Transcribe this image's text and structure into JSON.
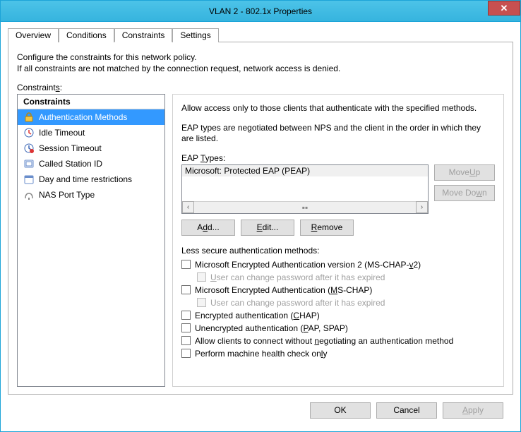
{
  "window": {
    "title": "VLAN 2 - 802.1x Properties",
    "close": "✕"
  },
  "tabs": {
    "overview": "Overview",
    "conditions": "Conditions",
    "constraints": "Constraints",
    "settings": "Settings"
  },
  "intro": {
    "line1": "Configure the constraints for this network policy.",
    "line2": "If all constraints are not matched by the connection request, network access is denied."
  },
  "constraints_label_pre": "Constraint",
  "constraints_label_ul": "s",
  "constraints_label_post": ":",
  "sidebar": {
    "header": "Constraints",
    "items": [
      {
        "label": "Authentication Methods"
      },
      {
        "label": "Idle Timeout"
      },
      {
        "label": "Session Timeout"
      },
      {
        "label": "Called Station ID"
      },
      {
        "label": "Day and time restrictions"
      },
      {
        "label": "NAS Port Type"
      }
    ]
  },
  "right": {
    "allow": "Allow access only to those clients that authenticate with the specified methods.",
    "negotiated": "EAP types are negotiated between NPS and the client in the order in which they are listed.",
    "eap_label_pre": "EAP ",
    "eap_label_ul": "T",
    "eap_label_post": "ypes:",
    "eap0": "Microsoft: Protected EAP (PEAP)",
    "moveup_pre": "Move ",
    "moveup_ul": "U",
    "moveup_post": "p",
    "movedown_pre": "Move Do",
    "movedown_ul": "w",
    "movedown_post": "n",
    "add_pre": "A",
    "add_ul": "d",
    "add_post": "d...",
    "edit_pre": "",
    "edit_ul": "E",
    "edit_post": "dit...",
    "remove_pre": "",
    "remove_ul": "R",
    "remove_post": "emove",
    "less_label": "Less secure authentication methods:",
    "ck0_pre": "Microsoft Encrypted Authentication version 2 (MS-CHAP-",
    "ck0_ul": "v",
    "ck0_post": "2)",
    "ck0a_pre": "",
    "ck0a_ul": "U",
    "ck0a_post": "ser can change password after it has expired",
    "ck1_pre": "Microsoft Encrypted Authentication (",
    "ck1_ul": "M",
    "ck1_post": "S-CHAP)",
    "ck1a_pre": "User can change password after it has expired",
    "ck2_pre": "Encrypted authentication (",
    "ck2_ul": "C",
    "ck2_post": "HAP)",
    "ck3_pre": "Unencrypted authentication (",
    "ck3_ul": "P",
    "ck3_post": "AP, SPAP)",
    "ck4_pre": "Allow clients to connect without ",
    "ck4_ul": "n",
    "ck4_post": "egotiating an authentication method",
    "ck5_pre": "Perform machine health check on",
    "ck5_ul": "l",
    "ck5_post": "y"
  },
  "footer": {
    "ok": "OK",
    "cancel": "Cancel",
    "apply_pre": "",
    "apply_ul": "A",
    "apply_post": "pply"
  }
}
